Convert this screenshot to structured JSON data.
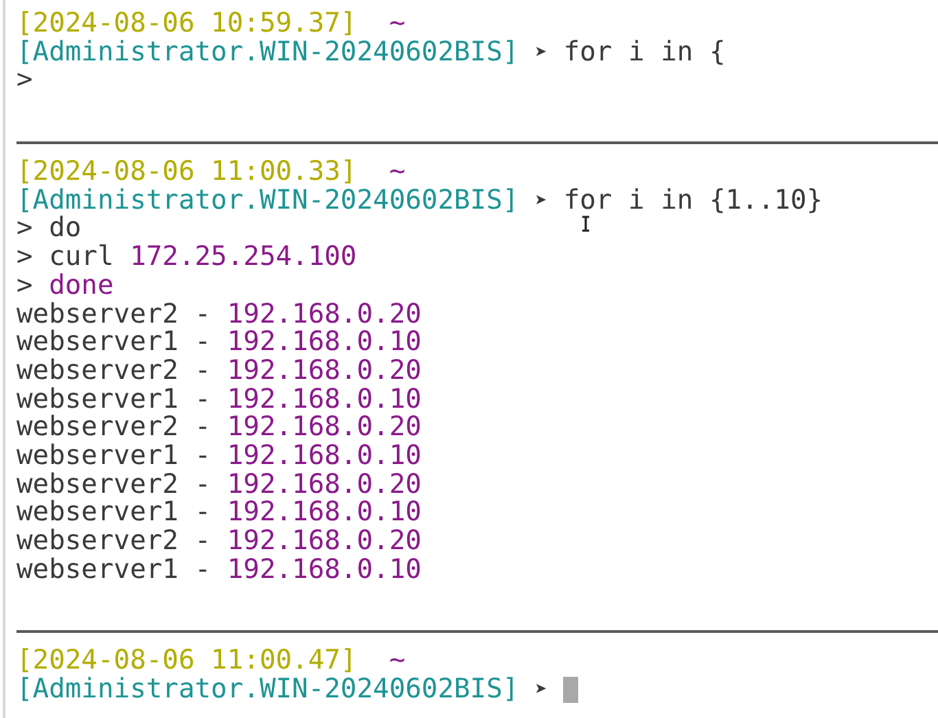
{
  "blocks": [
    {
      "timestamp": "[2024-08-06 10:59.37]",
      "tilde": "~",
      "user": "[Administrator.WIN-20240602BIS]",
      "arrow": "➤",
      "command": "for i in {",
      "lines": [
        {
          "marker": ">"
        }
      ]
    },
    {
      "timestamp": "[2024-08-06 11:00.33]",
      "tilde": "~",
      "user": "[Administrator.WIN-20240602BIS]",
      "arrow": "➤",
      "command": "for i in {1..10}",
      "pointer": true,
      "lines": [
        {
          "marker": ">",
          "parts": [
            {
              "text": "do",
              "kind": "plain"
            }
          ]
        },
        {
          "marker": ">",
          "parts": [
            {
              "text": "curl",
              "kind": "plain"
            },
            {
              "text": "172.25.254.100",
              "kind": "value"
            }
          ]
        },
        {
          "marker": ">",
          "parts": [
            {
              "text": "done",
              "kind": "value"
            }
          ]
        },
        {
          "parts": [
            {
              "text": "webserver2 -",
              "kind": "plain"
            },
            {
              "text": "192.168.0.20",
              "kind": "value"
            }
          ]
        },
        {
          "parts": [
            {
              "text": "webserver1 -",
              "kind": "plain"
            },
            {
              "text": "192.168.0.10",
              "kind": "value"
            }
          ]
        },
        {
          "parts": [
            {
              "text": "webserver2 -",
              "kind": "plain"
            },
            {
              "text": "192.168.0.20",
              "kind": "value"
            }
          ]
        },
        {
          "parts": [
            {
              "text": "webserver1 -",
              "kind": "plain"
            },
            {
              "text": "192.168.0.10",
              "kind": "value"
            }
          ]
        },
        {
          "parts": [
            {
              "text": "webserver2 -",
              "kind": "plain"
            },
            {
              "text": "192.168.0.20",
              "kind": "value"
            }
          ]
        },
        {
          "parts": [
            {
              "text": "webserver1 -",
              "kind": "plain"
            },
            {
              "text": "192.168.0.10",
              "kind": "value"
            }
          ]
        },
        {
          "parts": [
            {
              "text": "webserver2 -",
              "kind": "plain"
            },
            {
              "text": "192.168.0.20",
              "kind": "value"
            }
          ]
        },
        {
          "parts": [
            {
              "text": "webserver1 -",
              "kind": "plain"
            },
            {
              "text": "192.168.0.10",
              "kind": "value"
            }
          ]
        },
        {
          "parts": [
            {
              "text": "webserver2 -",
              "kind": "plain"
            },
            {
              "text": "192.168.0.20",
              "kind": "value"
            }
          ]
        },
        {
          "parts": [
            {
              "text": "webserver1 -",
              "kind": "plain"
            },
            {
              "text": "192.168.0.10",
              "kind": "value"
            }
          ]
        }
      ]
    },
    {
      "timestamp": "[2024-08-06 11:00.47]",
      "tilde": "~",
      "user": "[Administrator.WIN-20240602BIS]",
      "arrow": "➤",
      "cursor": true
    }
  ]
}
